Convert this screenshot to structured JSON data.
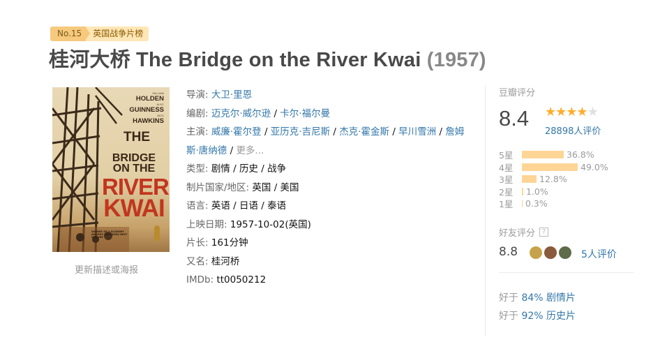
{
  "rank": {
    "no": "No.15",
    "name": "英国战争片榜"
  },
  "title": {
    "main": "桂河大桥 The Bridge on the River Kwai",
    "year": "(1957)"
  },
  "poster": {
    "cast": [
      "HOLDEN",
      "GUINNESS",
      "HAWKINS"
    ],
    "title_lines": [
      "THE",
      "BRIDGE",
      "ON THE",
      "RIVER",
      "KWAI"
    ],
    "award_text": "WINNER OF 7 ACADEMY AWARDS INCLUDING BEST PICTURE"
  },
  "update_link": "更新描述或海报",
  "info": {
    "director": {
      "label": "导演:",
      "names": [
        "大卫·里恩"
      ]
    },
    "writer": {
      "label": "编剧:",
      "names": [
        "迈克尔·威尔逊",
        "卡尔·福尔曼"
      ]
    },
    "cast": {
      "label": "主演:",
      "names": [
        "威廉·霍尔登",
        "亚历克·吉尼斯",
        "杰克·霍金斯",
        "早川雪洲",
        "詹姆斯·唐纳德"
      ],
      "more": "更多..."
    },
    "genre": {
      "label": "类型:",
      "value": "剧情 / 历史 / 战争"
    },
    "country": {
      "label": "制片国家/地区:",
      "value": "英国 / 美国"
    },
    "language": {
      "label": "语言:",
      "value": "英语 / 日语 / 泰语"
    },
    "release": {
      "label": "上映日期:",
      "value": "1957-10-02(英国)"
    },
    "runtime": {
      "label": "片长:",
      "value": "161分钟"
    },
    "aka": {
      "label": "又名:",
      "value": "桂河桥"
    },
    "imdb": {
      "label": "IMDb:",
      "value": "tt0050212"
    }
  },
  "rating": {
    "header": "豆瓣评分",
    "score": "8.4",
    "stars": 4,
    "count": "28898人评价",
    "distribution": [
      {
        "label": "5星",
        "pct": "36.8%",
        "value": 36.8
      },
      {
        "label": "4星",
        "pct": "49.0%",
        "value": 49.0
      },
      {
        "label": "3星",
        "pct": "12.8%",
        "value": 12.8
      },
      {
        "label": "2星",
        "pct": "1.0%",
        "value": 1.0
      },
      {
        "label": "1星",
        "pct": "0.3%",
        "value": 0.3
      }
    ]
  },
  "friends": {
    "header": "好友评分",
    "help": "?",
    "score": "8.8",
    "count": "5人评价",
    "avatar_colors": [
      "#c6a34a",
      "#8a5a3c",
      "#5f6b4a"
    ]
  },
  "better_than": [
    {
      "prefix": "好于",
      "pct": "84%",
      "genre": "剧情片"
    },
    {
      "prefix": "好于",
      "pct": "92%",
      "genre": "历史片"
    }
  ],
  "colors": {
    "link": "#3377aa",
    "star": "#ffac2d",
    "bar": "#ffd596",
    "badge": "#f7c97d"
  }
}
